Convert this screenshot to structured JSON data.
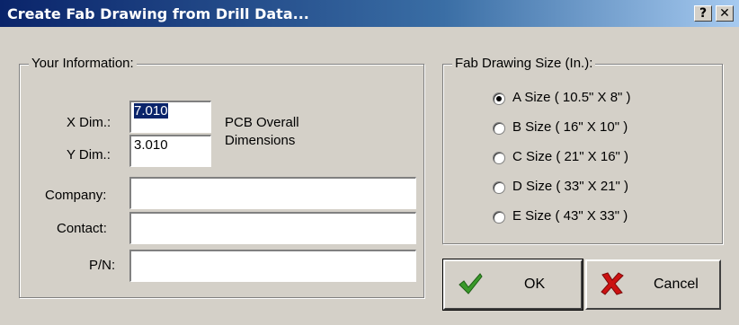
{
  "window": {
    "title": "Create Fab Drawing from Drill Data...",
    "help_glyph": "?",
    "close_glyph": "✕"
  },
  "info_group": {
    "title": "Your Information:",
    "x_dim": {
      "label": "X Dim.:",
      "value": "7.010"
    },
    "y_dim": {
      "label": "Y Dim.:",
      "value": "3.010"
    },
    "overall_caption": [
      "PCB Overall",
      "Dimensions"
    ],
    "company": {
      "label": "Company:",
      "value": ""
    },
    "contact": {
      "label": "Contact:",
      "value": ""
    },
    "pn": {
      "label": "P/N:",
      "value": ""
    }
  },
  "size_group": {
    "title": "Fab Drawing Size (In.):",
    "options": [
      {
        "label": "A Size ( 10.5\" X 8\" )",
        "selected": true
      },
      {
        "label": "B Size ( 16\" X 10\" )",
        "selected": false
      },
      {
        "label": "C Size ( 21\" X 16\" )",
        "selected": false
      },
      {
        "label": "D Size ( 33\" X 21\" )",
        "selected": false
      },
      {
        "label": "E Size ( 43\" X 33\" )",
        "selected": false
      }
    ]
  },
  "buttons": {
    "ok": {
      "label": "OK",
      "icon": "green-checkmark-icon",
      "color": "#3a9a2a"
    },
    "cancel": {
      "label": "Cancel",
      "icon": "red-x-icon",
      "color": "#cc1111"
    }
  }
}
